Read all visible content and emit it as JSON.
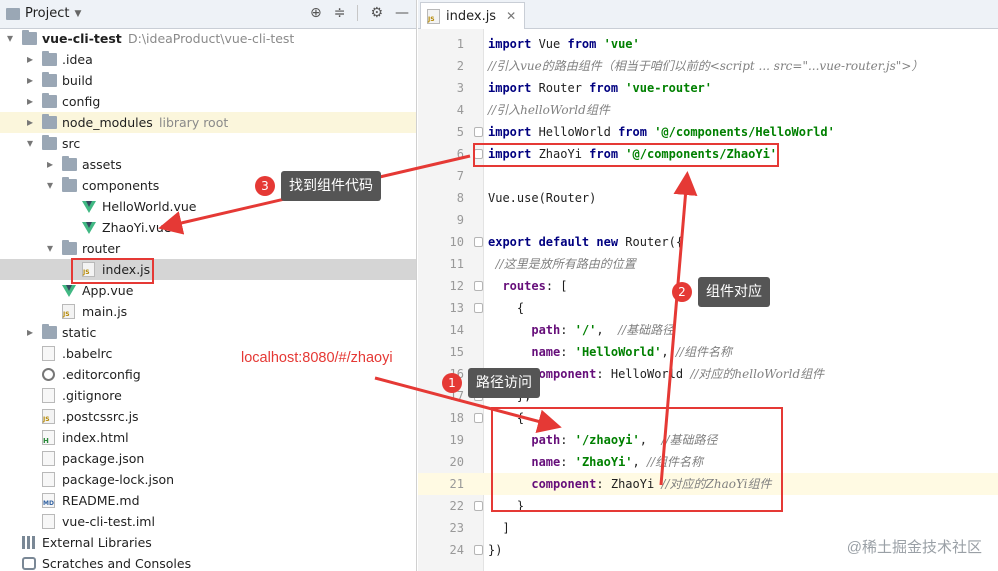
{
  "project_panel": {
    "title": "Project",
    "tree": [
      {
        "name": "vue-cli-test",
        "suffix": "D:\\ideaProduct\\vue-cli-test",
        "type": "folder",
        "expanded": true,
        "depth": 0
      },
      {
        "name": ".idea",
        "type": "folder",
        "depth": 1
      },
      {
        "name": "build",
        "type": "folder",
        "depth": 1
      },
      {
        "name": "config",
        "type": "folder",
        "depth": 1
      },
      {
        "name": "node_modules",
        "suffix": "library root",
        "type": "folder",
        "depth": 1,
        "highlight": true
      },
      {
        "name": "src",
        "type": "folder",
        "expanded": true,
        "depth": 1
      },
      {
        "name": "assets",
        "type": "folder",
        "depth": 2
      },
      {
        "name": "components",
        "type": "folder",
        "expanded": true,
        "depth": 2
      },
      {
        "name": "HelloWorld.vue",
        "type": "vue",
        "depth": 3
      },
      {
        "name": "ZhaoYi.vue",
        "type": "vue",
        "depth": 3
      },
      {
        "name": "router",
        "type": "folder",
        "expanded": true,
        "depth": 2
      },
      {
        "name": "index.js",
        "type": "js",
        "depth": 3,
        "selected": true
      },
      {
        "name": "App.vue",
        "type": "vue",
        "depth": 2
      },
      {
        "name": "main.js",
        "type": "js",
        "depth": 2
      },
      {
        "name": "static",
        "type": "folder",
        "depth": 1
      },
      {
        "name": ".babelrc",
        "type": "file",
        "depth": 1
      },
      {
        "name": ".editorconfig",
        "type": "gear",
        "depth": 1
      },
      {
        "name": ".gitignore",
        "type": "file",
        "depth": 1
      },
      {
        "name": ".postcssrc.js",
        "type": "js",
        "depth": 1
      },
      {
        "name": "index.html",
        "type": "html",
        "depth": 1
      },
      {
        "name": "package.json",
        "type": "file",
        "depth": 1
      },
      {
        "name": "package-lock.json",
        "type": "file",
        "depth": 1
      },
      {
        "name": "README.md",
        "type": "md",
        "depth": 1
      },
      {
        "name": "vue-cli-test.iml",
        "type": "file",
        "depth": 1
      },
      {
        "name": "External Libraries",
        "type": "lib",
        "depth": 0
      },
      {
        "name": "Scratches and Consoles",
        "type": "scratch",
        "depth": 0
      }
    ]
  },
  "editor": {
    "tab_label": "index.js",
    "current_line": 21,
    "lines": [
      {
        "n": 1,
        "tokens": [
          [
            "kw",
            "import"
          ],
          [
            "fn",
            " Vue "
          ],
          [
            "kw",
            "from"
          ],
          [
            "fn",
            " "
          ],
          [
            "str",
            "'vue'"
          ]
        ]
      },
      {
        "n": 2,
        "tokens": [
          [
            "cm",
            "//引入vue的路由组件（相当于咱们以前的<script ... src=\"...vue-router.js\">）"
          ]
        ]
      },
      {
        "n": 3,
        "tokens": [
          [
            "kw",
            "import"
          ],
          [
            "fn",
            " Router "
          ],
          [
            "kw",
            "from"
          ],
          [
            "fn",
            " "
          ],
          [
            "str",
            "'vue-router'"
          ]
        ]
      },
      {
        "n": 4,
        "tokens": [
          [
            "cm",
            "//引入helloWorld组件"
          ]
        ]
      },
      {
        "n": 5,
        "tokens": [
          [
            "kw",
            "import"
          ],
          [
            "fn",
            " HelloWorld "
          ],
          [
            "kw",
            "from"
          ],
          [
            "fn",
            " "
          ],
          [
            "str",
            "'@/components/HelloWorld'"
          ]
        ]
      },
      {
        "n": 6,
        "tokens": [
          [
            "kw",
            "import"
          ],
          [
            "fn",
            " ZhaoYi "
          ],
          [
            "kw",
            "from"
          ],
          [
            "fn",
            " "
          ],
          [
            "str",
            "'@/components/ZhaoYi'"
          ]
        ]
      },
      {
        "n": 7,
        "tokens": []
      },
      {
        "n": 8,
        "tokens": [
          [
            "fn",
            "Vue.use(Router)"
          ]
        ]
      },
      {
        "n": 9,
        "tokens": []
      },
      {
        "n": 10,
        "tokens": [
          [
            "kw",
            "export default new"
          ],
          [
            "fn",
            " Router({"
          ]
        ]
      },
      {
        "n": 11,
        "tokens": [
          [
            "cm",
            "  //这里是放所有路由的位置"
          ]
        ]
      },
      {
        "n": 12,
        "tokens": [
          [
            "fn",
            "  "
          ],
          [
            "prop",
            "routes"
          ],
          [
            "fn",
            ": ["
          ]
        ]
      },
      {
        "n": 13,
        "tokens": [
          [
            "fn",
            "    {"
          ]
        ]
      },
      {
        "n": 14,
        "tokens": [
          [
            "fn",
            "      "
          ],
          [
            "prop",
            "path"
          ],
          [
            "fn",
            ": "
          ],
          [
            "str",
            "'/'"
          ],
          [
            "fn",
            ",  "
          ],
          [
            "cm",
            "//基础路径"
          ]
        ]
      },
      {
        "n": 15,
        "tokens": [
          [
            "fn",
            "      "
          ],
          [
            "prop",
            "name"
          ],
          [
            "fn",
            ": "
          ],
          [
            "str",
            "'HelloWorld'"
          ],
          [
            "fn",
            ", "
          ],
          [
            "cm",
            "//组件名称"
          ]
        ]
      },
      {
        "n": 16,
        "tokens": [
          [
            "fn",
            "      "
          ],
          [
            "prop",
            "component"
          ],
          [
            "fn",
            ": HelloWorld "
          ],
          [
            "cm",
            "//对应的helloWorld组件"
          ]
        ]
      },
      {
        "n": 17,
        "tokens": [
          [
            "fn",
            "    },"
          ]
        ]
      },
      {
        "n": 18,
        "tokens": [
          [
            "fn",
            "    {"
          ]
        ]
      },
      {
        "n": 19,
        "tokens": [
          [
            "fn",
            "      "
          ],
          [
            "prop",
            "path"
          ],
          [
            "fn",
            ": "
          ],
          [
            "str",
            "'/zhaoyi'"
          ],
          [
            "fn",
            ",  "
          ],
          [
            "cm",
            "//基础路径"
          ]
        ]
      },
      {
        "n": 20,
        "tokens": [
          [
            "fn",
            "      "
          ],
          [
            "prop",
            "name"
          ],
          [
            "fn",
            ": "
          ],
          [
            "str",
            "'ZhaoYi'"
          ],
          [
            "fn",
            ", "
          ],
          [
            "cm",
            "//组件名称"
          ]
        ]
      },
      {
        "n": 21,
        "tokens": [
          [
            "fn",
            "      "
          ],
          [
            "prop",
            "component"
          ],
          [
            "fn",
            ": ZhaoYi "
          ],
          [
            "cm",
            "//对应的ZhaoYi组件"
          ]
        ]
      },
      {
        "n": 22,
        "tokens": [
          [
            "fn",
            "    }"
          ]
        ]
      },
      {
        "n": 23,
        "tokens": [
          [
            "fn",
            "  ]"
          ]
        ]
      },
      {
        "n": 24,
        "tokens": [
          [
            "fn",
            "})"
          ]
        ]
      }
    ]
  },
  "annotations": {
    "callout_1": {
      "number": "1",
      "text": "路径访问"
    },
    "callout_2": {
      "number": "2",
      "text": "组件对应"
    },
    "callout_3": {
      "number": "3",
      "text": "找到组件代码"
    },
    "url": "localhost:8080/#/zhaoyi",
    "accent_color": "#e53935"
  },
  "watermark": "@稀土掘金技术社区"
}
